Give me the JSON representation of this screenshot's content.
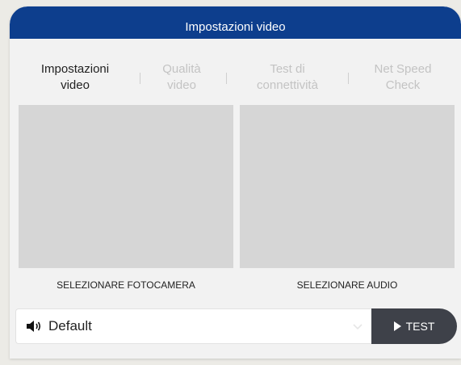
{
  "header": {
    "title": "Impostazioni video"
  },
  "tabs": [
    {
      "line1": "Impostazioni",
      "line2": "video",
      "active": true
    },
    {
      "line1": "Qualità",
      "line2": "video",
      "active": false
    },
    {
      "line1": "Test di",
      "line2": "connettività",
      "active": false
    },
    {
      "line1": "Net Speed",
      "line2": "Check",
      "active": false
    }
  ],
  "camera": {
    "label": "SELEZIONARE FOTOCAMERA"
  },
  "audio": {
    "label": "SELEZIONARE AUDIO"
  },
  "device_select": {
    "value": "Default",
    "icon": "speaker-icon"
  },
  "test_button": {
    "label": "TEST",
    "icon": "play-icon"
  },
  "colors": {
    "header_bg": "#0d3e8d",
    "button_bg": "#3e4149",
    "preview_bg": "#d6d6d6"
  }
}
